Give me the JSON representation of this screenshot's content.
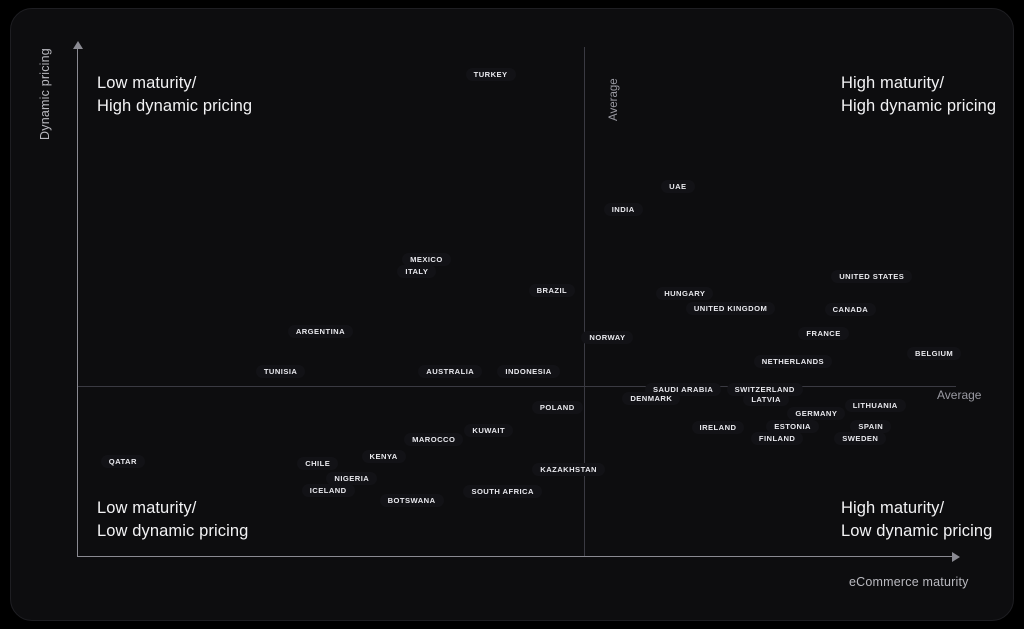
{
  "chart_data": {
    "type": "scatter",
    "title": "",
    "xlabel": "eCommerce maturity",
    "ylabel": "Dynamic pricing",
    "xlim": [
      0,
      100
    ],
    "ylim": [
      0,
      100
    ],
    "grid": false,
    "legend": "none",
    "annotations": {
      "quadrant_top_left": "Low maturity/\nHigh dynamic pricing",
      "quadrant_top_right": "High maturity/\nHigh dynamic pricing",
      "quadrant_bottom_left": "Low maturity/\nLow dynamic pricing",
      "quadrant_bottom_right": "High maturity/\nLow dynamic pricing",
      "average_vertical": "Average",
      "average_horizontal": "Average"
    },
    "reference_lines": {
      "x_average": 57.6,
      "y_average": 33.3
    },
    "points": [
      {
        "label": "TURKEY",
        "x": 47.0,
        "y": 95.7,
        "gradient": "teal-purple"
      },
      {
        "label": "UAE",
        "x": 68.3,
        "y": 73.4,
        "gradient": "teal-purple"
      },
      {
        "label": "INDIA",
        "x": 62.1,
        "y": 68.7,
        "gradient": "teal-purple"
      },
      {
        "label": "MEXICO",
        "x": 39.7,
        "y": 58.9,
        "gradient": "teal-purple"
      },
      {
        "label": "ITALY",
        "x": 38.6,
        "y": 56.4,
        "gradient": "teal-purple"
      },
      {
        "label": "BRAZIL",
        "x": 54.0,
        "y": 52.6,
        "gradient": "purple-teal"
      },
      {
        "label": "UNITED STATES",
        "x": 90.4,
        "y": 55.4,
        "gradient": "teal-purple"
      },
      {
        "label": "HUNGARY",
        "x": 69.1,
        "y": 52.0,
        "gradient": "teal-purple"
      },
      {
        "label": "UNITED KINGDOM",
        "x": 74.3,
        "y": 49.1,
        "gradient": "teal-purple"
      },
      {
        "label": "CANADA",
        "x": 88.0,
        "y": 49.0,
        "gradient": "teal-purple"
      },
      {
        "label": "ARGENTINA",
        "x": 27.6,
        "y": 44.6,
        "gradient": "teal-purple"
      },
      {
        "label": "FRANCE",
        "x": 84.9,
        "y": 44.2,
        "gradient": "purple-teal"
      },
      {
        "label": "NORWAY",
        "x": 60.3,
        "y": 43.4,
        "gradient": "teal-purple"
      },
      {
        "label": "BELGIUM",
        "x": 97.5,
        "y": 40.2,
        "gradient": "teal-purple"
      },
      {
        "label": "NETHERLANDS",
        "x": 81.4,
        "y": 38.6,
        "gradient": "teal-purple"
      },
      {
        "label": "TUNISIA",
        "x": 23.1,
        "y": 36.6,
        "gradient": "teal-purple"
      },
      {
        "label": "AUSTRALIA",
        "x": 42.4,
        "y": 36.6,
        "gradient": "teal-purple"
      },
      {
        "label": "INDONESIA",
        "x": 51.3,
        "y": 36.6,
        "gradient": "purple-teal"
      },
      {
        "label": "SAUDI ARABIA",
        "x": 68.9,
        "y": 33.0,
        "gradient": "purple-teal"
      },
      {
        "label": "SWITZERLAND",
        "x": 78.2,
        "y": 33.0,
        "gradient": "teal-purple"
      },
      {
        "label": "DENMARK",
        "x": 65.3,
        "y": 31.2,
        "gradient": "teal-purple"
      },
      {
        "label": "LATVIA",
        "x": 78.4,
        "y": 31.0,
        "gradient": "teal-purple"
      },
      {
        "label": "LITHUANIA",
        "x": 90.8,
        "y": 29.8,
        "gradient": "purple-teal"
      },
      {
        "label": "POLAND",
        "x": 54.6,
        "y": 29.5,
        "gradient": "teal-purple"
      },
      {
        "label": "GERMANY",
        "x": 84.1,
        "y": 28.2,
        "gradient": "purple-teal"
      },
      {
        "label": "ESTONIA",
        "x": 81.4,
        "y": 25.7,
        "gradient": "teal-purple"
      },
      {
        "label": "SPAIN",
        "x": 90.3,
        "y": 25.6,
        "gradient": "purple-teal"
      },
      {
        "label": "IRELAND",
        "x": 72.9,
        "y": 25.5,
        "gradient": "teal-purple"
      },
      {
        "label": "KUWAIT",
        "x": 46.8,
        "y": 24.8,
        "gradient": "purple-teal"
      },
      {
        "label": "FINLAND",
        "x": 79.6,
        "y": 23.2,
        "gradient": "teal-purple"
      },
      {
        "label": "SWEDEN",
        "x": 89.1,
        "y": 23.2,
        "gradient": "teal-purple"
      },
      {
        "label": "MAROCCO",
        "x": 40.5,
        "y": 23.0,
        "gradient": "teal-purple"
      },
      {
        "label": "KENYA",
        "x": 34.8,
        "y": 19.7,
        "gradient": "teal-purple"
      },
      {
        "label": "QATAR",
        "x": 5.1,
        "y": 18.6,
        "gradient": "teal-purple"
      },
      {
        "label": "CHILE",
        "x": 27.3,
        "y": 18.2,
        "gradient": "teal-purple"
      },
      {
        "label": "KAZAKHSTAN",
        "x": 55.9,
        "y": 17.1,
        "gradient": "teal-purple"
      },
      {
        "label": "NIGERIA",
        "x": 31.2,
        "y": 15.3,
        "gradient": "teal-purple"
      },
      {
        "label": "ICELAND",
        "x": 28.5,
        "y": 13.0,
        "gradient": "teal-purple"
      },
      {
        "label": "SOUTH AFRICA",
        "x": 48.4,
        "y": 12.8,
        "gradient": "teal-purple"
      },
      {
        "label": "BOTSWANA",
        "x": 38.0,
        "y": 11.0,
        "gradient": "teal-purple"
      }
    ]
  },
  "colors": {
    "background": "#000000",
    "card": "#0d0d0f",
    "accent_teal": "#1fbf9b",
    "accent_purple": "#7d4fd1",
    "axis": "#8a8a92",
    "average_line": "#3a3a42",
    "text": "#f2f2f4"
  }
}
